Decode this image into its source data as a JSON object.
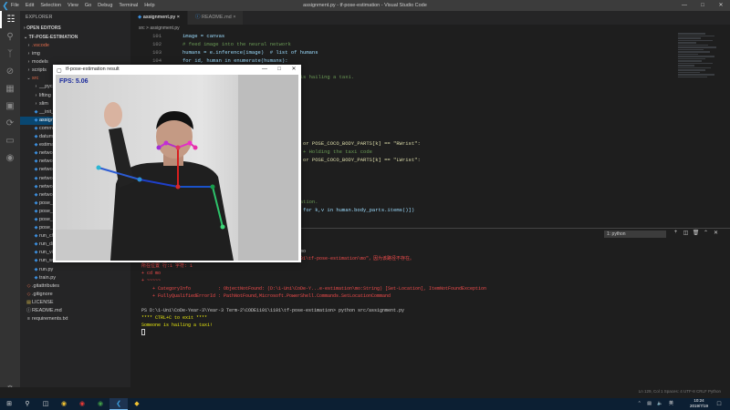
{
  "window": {
    "title": "assignment.py - tf-pose-estimation - Visual Studio Code",
    "menu": [
      "File",
      "Edit",
      "Selection",
      "View",
      "Go",
      "Debug",
      "Terminal",
      "Help"
    ]
  },
  "sidebar": {
    "header": "EXPLORER",
    "open_editors": "OPEN EDITORS",
    "project": "TF-POSE-ESTIMATION",
    "items": [
      {
        "label": ".vscode",
        "icon": "folder-icon"
      },
      {
        "label": "img",
        "icon": "folder-icon"
      },
      {
        "label": "models",
        "icon": "folder-icon"
      },
      {
        "label": "scripts",
        "icon": "folder-icon"
      },
      {
        "label": "src",
        "icon": "folder-open-icon"
      },
      {
        "label": "__pycache__",
        "icon": "folder-icon"
      },
      {
        "label": "lifting",
        "icon": "folder-icon"
      },
      {
        "label": "slim",
        "icon": "folder-icon"
      },
      {
        "label": "__init__.py",
        "icon": "python-file-icon"
      },
      {
        "label": "assignment.py",
        "icon": "python-file-icon"
      },
      {
        "label": "common.py",
        "icon": "python-file-icon"
      },
      {
        "label": "datum_pb2.py",
        "icon": "python-file-icon"
      },
      {
        "label": "estimator.py",
        "icon": "python-file-icon"
      },
      {
        "label": "networks.py",
        "icon": "python-file-icon"
      },
      {
        "label": "network_base.py",
        "icon": "python-file-icon"
      },
      {
        "label": "network_cmu.py",
        "icon": "python-file-icon"
      },
      {
        "label": "network_dsconv.py",
        "icon": "python-file-icon"
      },
      {
        "label": "network_mobilenet.py",
        "icon": "python-file-icon"
      },
      {
        "label": "network_personlab.py",
        "icon": "python-file-icon"
      },
      {
        "label": "pose_augment.py",
        "icon": "python-file-icon"
      },
      {
        "label": "pose_dataset.py",
        "icon": "python-file-icon"
      },
      {
        "label": "pose_datacoco.py",
        "icon": "python-file-icon"
      },
      {
        "label": "pose_dataworker.py",
        "icon": "python-file-icon"
      },
      {
        "label": "run_checkpoint.py",
        "icon": "python-file-icon"
      },
      {
        "label": "run_directory.py",
        "icon": "python-file-icon"
      },
      {
        "label": "run_video.py",
        "icon": "python-file-icon"
      },
      {
        "label": "run_webcam.py",
        "icon": "python-file-icon"
      },
      {
        "label": "run.py",
        "icon": "python-file-icon"
      },
      {
        "label": "train.py",
        "icon": "python-file-icon"
      },
      {
        "label": ".gitattributes",
        "icon": "git-icon"
      },
      {
        "label": ".gitignore",
        "icon": "git-icon"
      },
      {
        "label": "LICENSE",
        "icon": "license-icon"
      },
      {
        "label": "README.md",
        "icon": "info-icon"
      },
      {
        "label": "requirements.txt",
        "icon": "text-file-icon"
      }
    ]
  },
  "tabs": [
    {
      "label": "assignment.py",
      "active": true
    },
    {
      "label": "README.md",
      "active": false
    }
  ],
  "breadcrumb": "src  >  assignment.py",
  "editor": {
    "line_numbers": [
      "101",
      "102",
      "103",
      "104",
      "105",
      "",
      "",
      "",
      "",
      "",
      "",
      "",
      "",
      "",
      "",
      "",
      "",
      "",
      "",
      "",
      "",
      "",
      ""
    ],
    "lines": [
      "image = canvas",
      "# feed image into the neural network",
      "humans = e.inference(image)  # list of humans",
      "for id, human in enumerate(humans):",
      "",
      "                               someone is hailing a taxi.",
      "                               nd.",
      "",
      "",
      "",
      "",
      "                               ose\"",
      "",
      "                               \"LElbow\" or POSE_COCO_BODY_PARTS[k] == \"RWrist\":",
      "                               hand ups + Holding the taxi code",
      "                               \"LElbow\" or POSE_COCO_BODY_PARTS[k] == \"LWrist\":",
      "",
      "                               se:",
      "",
      "",
      "                               demonstration.",
      "                               .x, v.y) for k,v in human.body_parts.items()])",
      ""
    ]
  },
  "terminal": {
    "selector": "1: python",
    "lines": [
      {
        "text": "",
        "cls": "white"
      },
      {
        "text": "                                                       cd mo",
        "cls": "white"
      },
      {
        "text": "                                                       \\1101\\tf-pose-estimation\\mo\"，因为该路径不存在。",
        "cls": "err"
      },
      {
        "text": "所在位置 行:1 字符: 1",
        "cls": "err"
      },
      {
        "text": "+ cd mo",
        "cls": "err"
      },
      {
        "text": "+ ~~~~~",
        "cls": "err"
      },
      {
        "text": "    + CategoryInfo          : ObjectNotFound: (D:\\1-Uni\\CoDe-Y...e-estimation\\mo:String) [Set-Location], ItemNotFoundException",
        "cls": "err"
      },
      {
        "text": "    + FullyQualifiedErrorId : PathNotFound,Microsoft.PowerShell.Commands.SetLocationCommand",
        "cls": "err"
      },
      {
        "text": "",
        "cls": "white"
      },
      {
        "text": "PS D:\\1-Uni\\CoDe-Year-3\\Year-3 Term-2\\CODE1101\\1101\\tf-pose-estimation> python src/assignment.py",
        "cls": "white"
      },
      {
        "text": "**** CTRL+C to exit ****",
        "cls": "yel"
      },
      {
        "text": "Someone is hailing a taxi!",
        "cls": "yel"
      }
    ]
  },
  "pose_window": {
    "title": "tf-pose-estimation result",
    "fps": "FPS: 5.06"
  },
  "statusbar": {
    "right": "Ln 129, Col 1   Spaces: 4   UTF-8   CRLF   Python"
  },
  "taskbar": {
    "time": "10:24",
    "date": "2019/7/19",
    "lang": "英"
  }
}
